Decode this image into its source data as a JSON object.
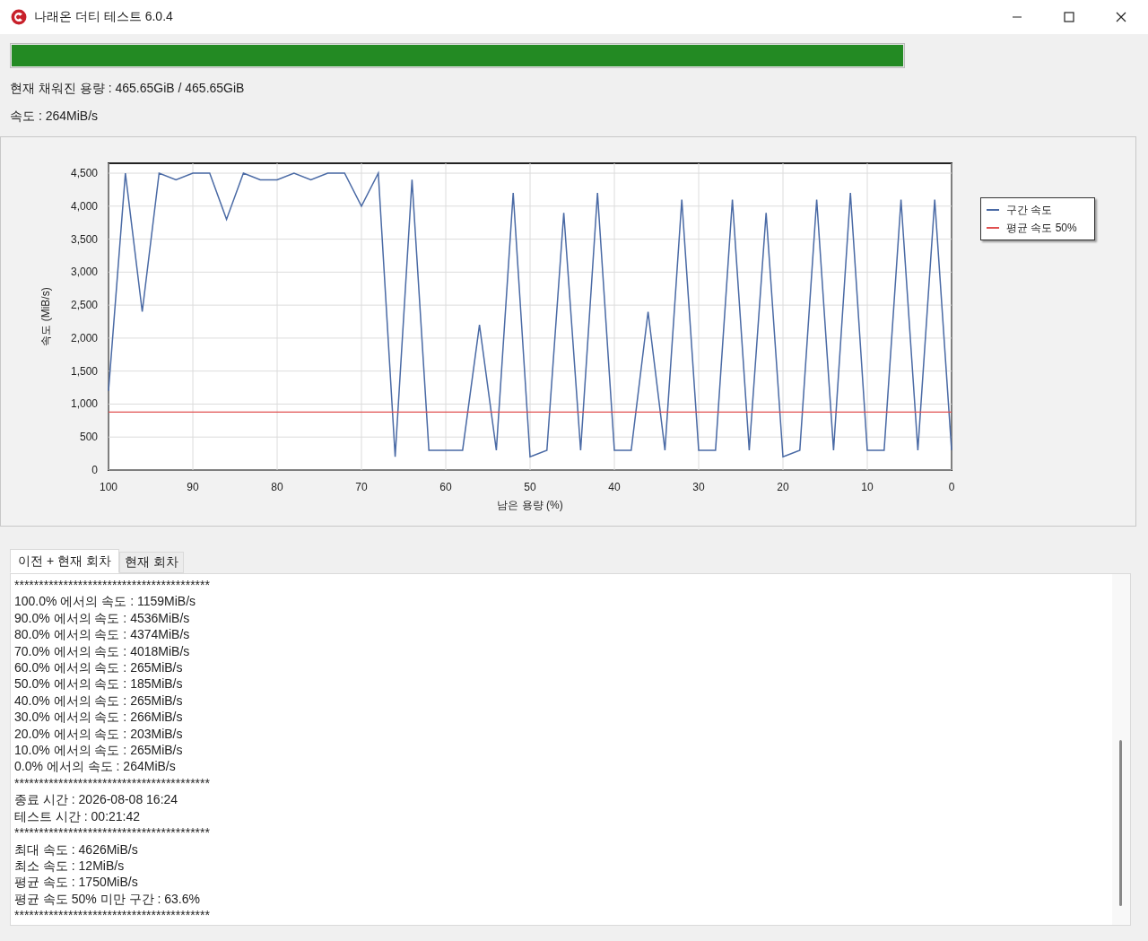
{
  "window": {
    "title": "나래온 더티 테스트 6.0.4"
  },
  "progress": {
    "level": 1
  },
  "filled_capacity": "현재 채워진 용량 : 465.65GiB / 465.65GiB",
  "speed": "속도 : 264MiB/s",
  "chart": {
    "chart_data": {
      "type": "line",
      "xlabel": "남은 용량 (%)",
      "ylabel": "속도 (MiB/s)",
      "x": [
        100,
        98,
        96,
        94,
        92,
        90,
        88,
        86,
        84,
        82,
        80,
        78,
        76,
        74,
        72,
        70,
        68,
        66,
        64,
        62,
        60,
        58,
        56,
        54,
        52,
        50,
        48,
        46,
        44,
        42,
        40,
        38,
        36,
        34,
        32,
        30,
        28,
        26,
        24,
        22,
        20,
        18,
        16,
        14,
        12,
        10,
        8,
        6,
        4,
        2,
        0
      ],
      "series": [
        {
          "name": "구간 속도",
          "color": "#4a6aa5",
          "values": [
            1200,
            4500,
            2400,
            4500,
            4400,
            4500,
            4500,
            3800,
            4500,
            4400,
            4400,
            4500,
            4400,
            4500,
            4500,
            4000,
            4500,
            200,
            4400,
            300,
            300,
            300,
            2200,
            300,
            4200,
            200,
            300,
            3900,
            300,
            4200,
            300,
            300,
            2400,
            300,
            4100,
            300,
            300,
            4100,
            300,
            3900,
            200,
            300,
            4100,
            300,
            4200,
            300,
            300,
            4100,
            300,
            4100,
            300
          ]
        },
        {
          "name": "평균 속도 50%",
          "color": "#e05050",
          "values": [
            880,
            880,
            880,
            880,
            880,
            880,
            880,
            880,
            880,
            880,
            880,
            880,
            880,
            880,
            880,
            880,
            880,
            880,
            880,
            880,
            880,
            880,
            880,
            880,
            880,
            880,
            880,
            880,
            880,
            880,
            880,
            880,
            880,
            880,
            880,
            880,
            880,
            880,
            880,
            880,
            880,
            880,
            880,
            880,
            880,
            880,
            880,
            880,
            880,
            880,
            880
          ]
        }
      ],
      "xlim": [
        100,
        0
      ],
      "ylim": [
        0,
        4650
      ],
      "grid": true,
      "legend": true,
      "xticks": [
        100,
        90,
        80,
        70,
        60,
        50,
        40,
        30,
        20,
        10,
        0
      ],
      "yticks": [
        {
          "value": 0,
          "label": "0"
        },
        {
          "value": 500,
          "label": "500"
        },
        {
          "value": 1000,
          "label": "1,000"
        },
        {
          "value": 1500,
          "label": "1,500"
        },
        {
          "value": 2000,
          "label": "2,000"
        },
        {
          "value": 2500,
          "label": "2,500"
        },
        {
          "value": 3000,
          "label": "3,000"
        },
        {
          "value": 3500,
          "label": "3,500"
        },
        {
          "value": 4000,
          "label": "4,000"
        },
        {
          "value": 4500,
          "label": "4,500"
        }
      ]
    }
  },
  "tabs": [
    {
      "label": "이전 + 현재 회차",
      "selected": true
    },
    {
      "label": "현재 회차",
      "selected": false
    }
  ],
  "log": [
    "****************************************",
    "100.0% 에서의 속도 : 1159MiB/s",
    "90.0% 에서의 속도 : 4536MiB/s",
    "80.0% 에서의 속도 : 4374MiB/s",
    "70.0% 에서의 속도 : 4018MiB/s",
    "60.0% 에서의 속도 : 265MiB/s",
    "50.0% 에서의 속도 : 185MiB/s",
    "40.0% 에서의 속도 : 265MiB/s",
    "30.0% 에서의 속도 : 266MiB/s",
    "20.0% 에서의 속도 : 203MiB/s",
    "10.0% 에서의 속도 : 265MiB/s",
    "0.0% 에서의 속도 : 264MiB/s",
    "****************************************",
    "종료 시간 : 2026-08-08 16:24",
    "테스트 시간 : 00:21:42",
    "****************************************",
    "최대 속도 : 4626MiB/s",
    "최소 속도 : 12MiB/s",
    "평균 속도 : 1750MiB/s",
    "평균 속도 50% 미만 구간 : 63.6%",
    "****************************************"
  ]
}
